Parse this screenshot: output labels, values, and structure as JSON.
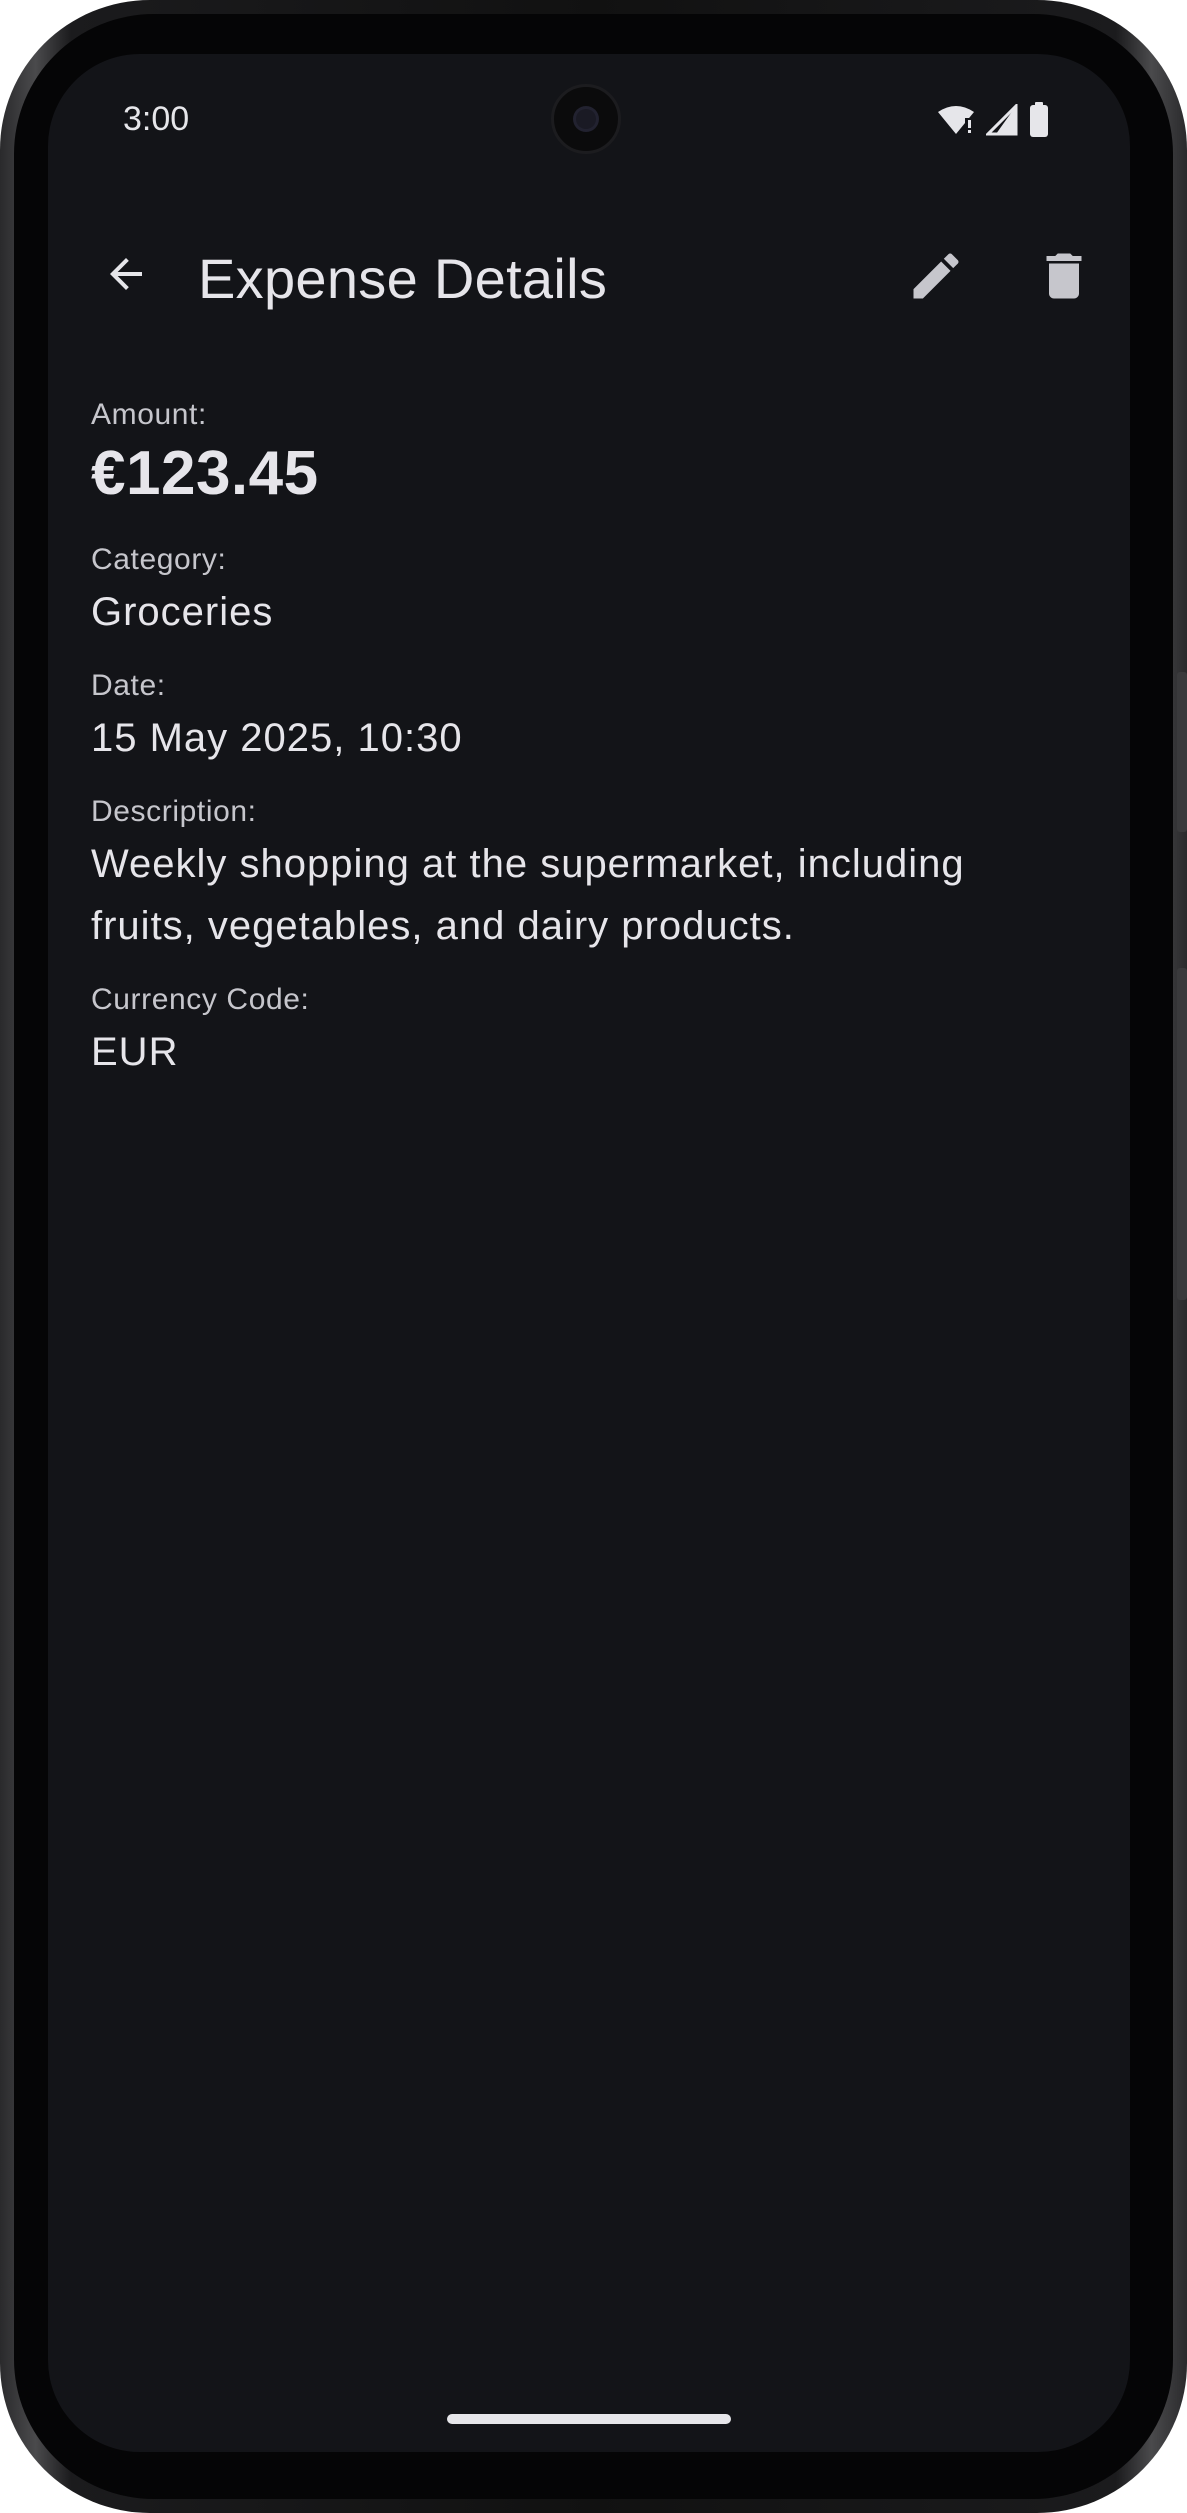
{
  "status_bar": {
    "time": "3:00",
    "icons": [
      "wifi-alert-icon",
      "cellular-signal-icon",
      "battery-icon"
    ]
  },
  "app_bar": {
    "title": "Expense Details",
    "back_icon": "arrow-back-icon",
    "edit_icon": "pencil-icon",
    "delete_icon": "trash-icon"
  },
  "expense": {
    "amount_label": "Amount:",
    "amount_value": "€123.45",
    "category_label": "Category:",
    "category_value": "Groceries",
    "date_label": "Date:",
    "date_value": "15 May 2025, 10:30",
    "description_label": "Description:",
    "description_value": "Weekly shopping at the supermarket, including fruits, vegetables, and dairy products.",
    "currency_label": "Currency Code:",
    "currency_value": "EUR"
  },
  "colors": {
    "background": "#131418",
    "text_primary": "#e6e5ea",
    "text_secondary": "#c6c6cc"
  }
}
